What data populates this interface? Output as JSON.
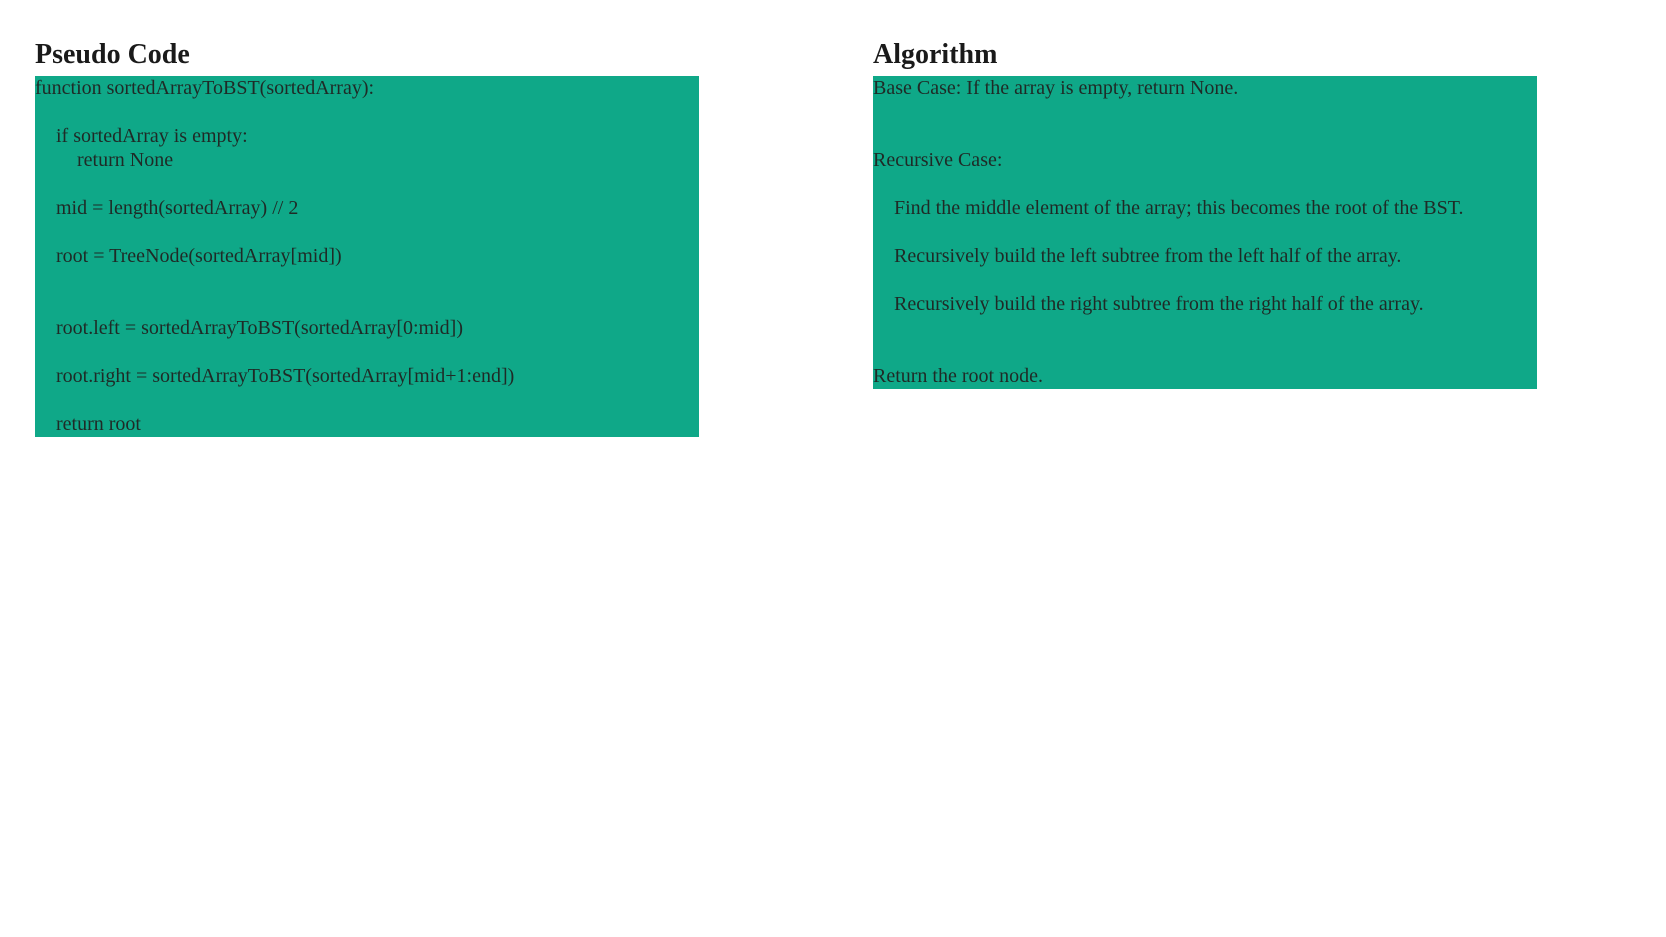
{
  "pseudo_code": {
    "heading": "Pseudo Code",
    "lines": {
      "l1": "function sortedArrayToBST(sortedArray):",
      "l2": "if sortedArray is empty:",
      "l3": "return None",
      "l4": "mid = length(sortedArray) // 2",
      "l5": "root = TreeNode(sortedArray[mid])",
      "l6": "root.left = sortedArrayToBST(sortedArray[0:mid])",
      "l7": "root.right = sortedArrayToBST(sortedArray[mid+1:end])",
      "l8": "return root"
    }
  },
  "algorithm": {
    "heading": "Algorithm",
    "base_case": "Base Case: If the array is empty, return None.",
    "recursive_case": "Recursive Case:",
    "steps": [
      "Find the middle element of the array; this becomes the root of the BST.",
      "Recursively build the left subtree from the left half of the array.",
      "Recursively build the right subtree from the right half of the array."
    ],
    "return_step": "Return the root node."
  },
  "colors": {
    "panel_background": "#0fa888",
    "text": "#1f2a26",
    "page_background": "#ffffff"
  }
}
